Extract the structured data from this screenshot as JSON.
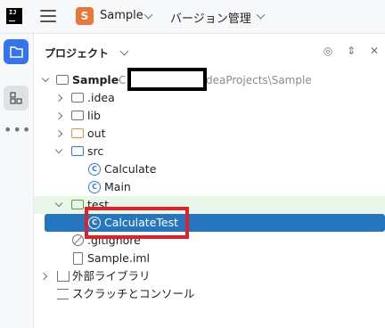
{
  "header": {
    "logo_text": "IJ",
    "project_initial": "S",
    "project_name": "Sample",
    "vcs_label": "バージョン管理"
  },
  "panel": {
    "title": "プロジェクト"
  },
  "tree": {
    "root_name": "Sample",
    "root_path_start": "C",
    "root_path_end": "deaProjects\\Sample",
    "items": [
      {
        "label": ".idea"
      },
      {
        "label": "lib"
      },
      {
        "label": "out"
      },
      {
        "label": "src"
      },
      {
        "label": "Calculate"
      },
      {
        "label": "Main"
      },
      {
        "label": "test"
      },
      {
        "label": "CalculateTest"
      },
      {
        "label": ".gitignore"
      },
      {
        "label": "Sample.iml"
      },
      {
        "label": "外部ライブラリ"
      },
      {
        "label": "スクラッチとコンソール"
      }
    ]
  },
  "icons": {
    "class_glyph": "C"
  },
  "colors": {
    "accent": "#3574f0",
    "selection": "#2675bf",
    "callout": "#e0202a"
  }
}
